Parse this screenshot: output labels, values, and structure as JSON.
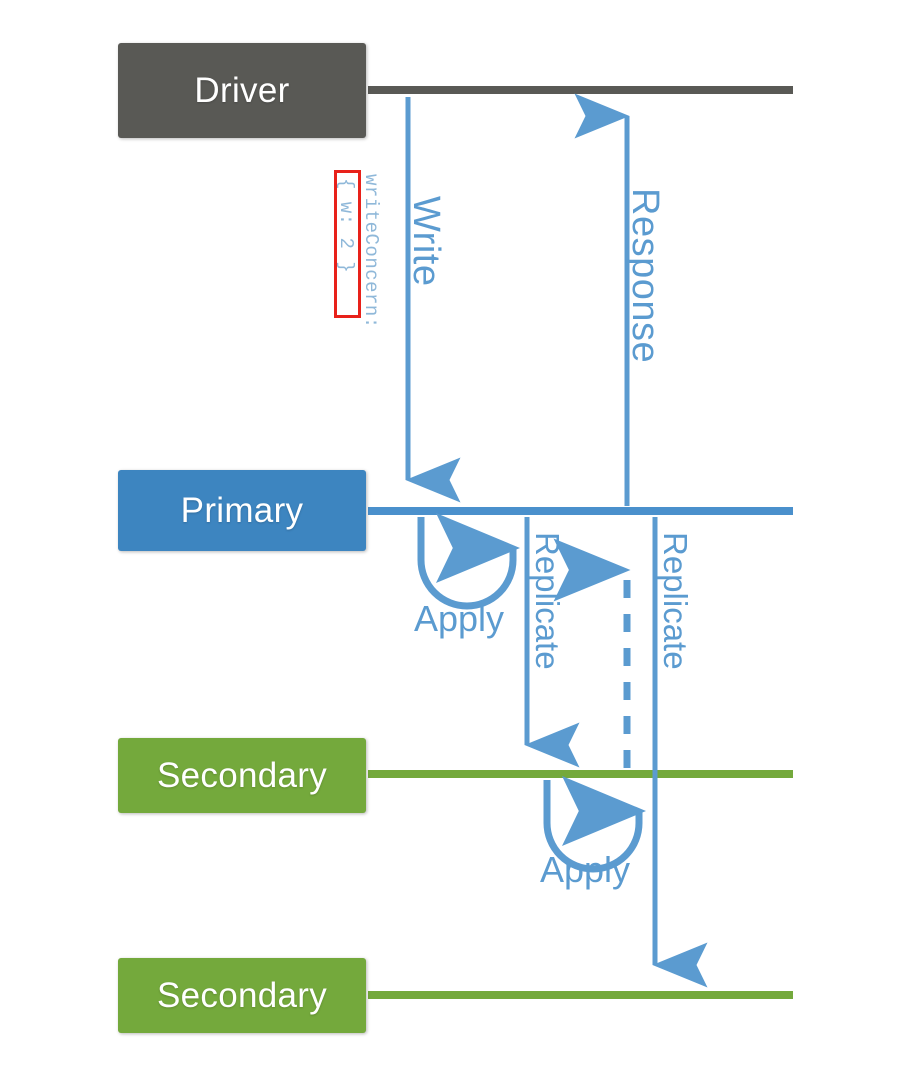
{
  "diagram": {
    "title": "MongoDB Write Concern Replication Sequence",
    "type": "sequence-diagram",
    "background_color": "#ffffff",
    "colors": {
      "driver": "#595955",
      "primary": "#3d85c0",
      "secondary": "#74a93c",
      "arrow_blue": "#5b9bd0",
      "highlight_red": "#e8211a",
      "label_text": "#ffffff",
      "write_concern_text": "#8fb8d9"
    },
    "actors": [
      {
        "id": "driver",
        "label": "Driver",
        "color": "#595955",
        "lifeline_color": "#595955"
      },
      {
        "id": "primary",
        "label": "Primary",
        "color": "#3d85c0",
        "lifeline_color": "#4a90cc"
      },
      {
        "id": "secondary1",
        "label": "Secondary",
        "color": "#74a93c",
        "lifeline_color": "#74a93c"
      },
      {
        "id": "secondary2",
        "label": "Secondary",
        "color": "#74a93c",
        "lifeline_color": "#74a93c"
      }
    ],
    "messages": [
      {
        "id": "write",
        "label": "Write",
        "from": "driver",
        "to": "primary",
        "direction": "down",
        "style": "solid"
      },
      {
        "id": "apply-primary",
        "label": "Apply",
        "from": "primary",
        "to": "primary",
        "direction": "self",
        "style": "solid-arc"
      },
      {
        "id": "replicate-1",
        "label": "Replicate",
        "from": "primary",
        "to": "secondary1",
        "direction": "down",
        "style": "solid"
      },
      {
        "id": "apply-secondary",
        "label": "Apply",
        "from": "secondary1",
        "to": "secondary1",
        "direction": "self",
        "style": "solid-arc"
      },
      {
        "id": "acknowledge",
        "label": "",
        "from": "secondary1",
        "to": "primary",
        "direction": "up",
        "style": "dashed"
      },
      {
        "id": "replicate-2",
        "label": "Replicate",
        "from": "primary",
        "to": "secondary2",
        "direction": "down",
        "style": "solid"
      },
      {
        "id": "response",
        "label": "Response",
        "from": "primary",
        "to": "driver",
        "direction": "up",
        "style": "solid"
      }
    ],
    "annotations": {
      "write_concern_full": "writeConcern: { w: 2 }",
      "write_concern_prefix": "writeConcern:",
      "write_concern_value": "{ w: 2 }",
      "write_concern_highlighted": true,
      "highlight_color": "#e8211a"
    }
  }
}
